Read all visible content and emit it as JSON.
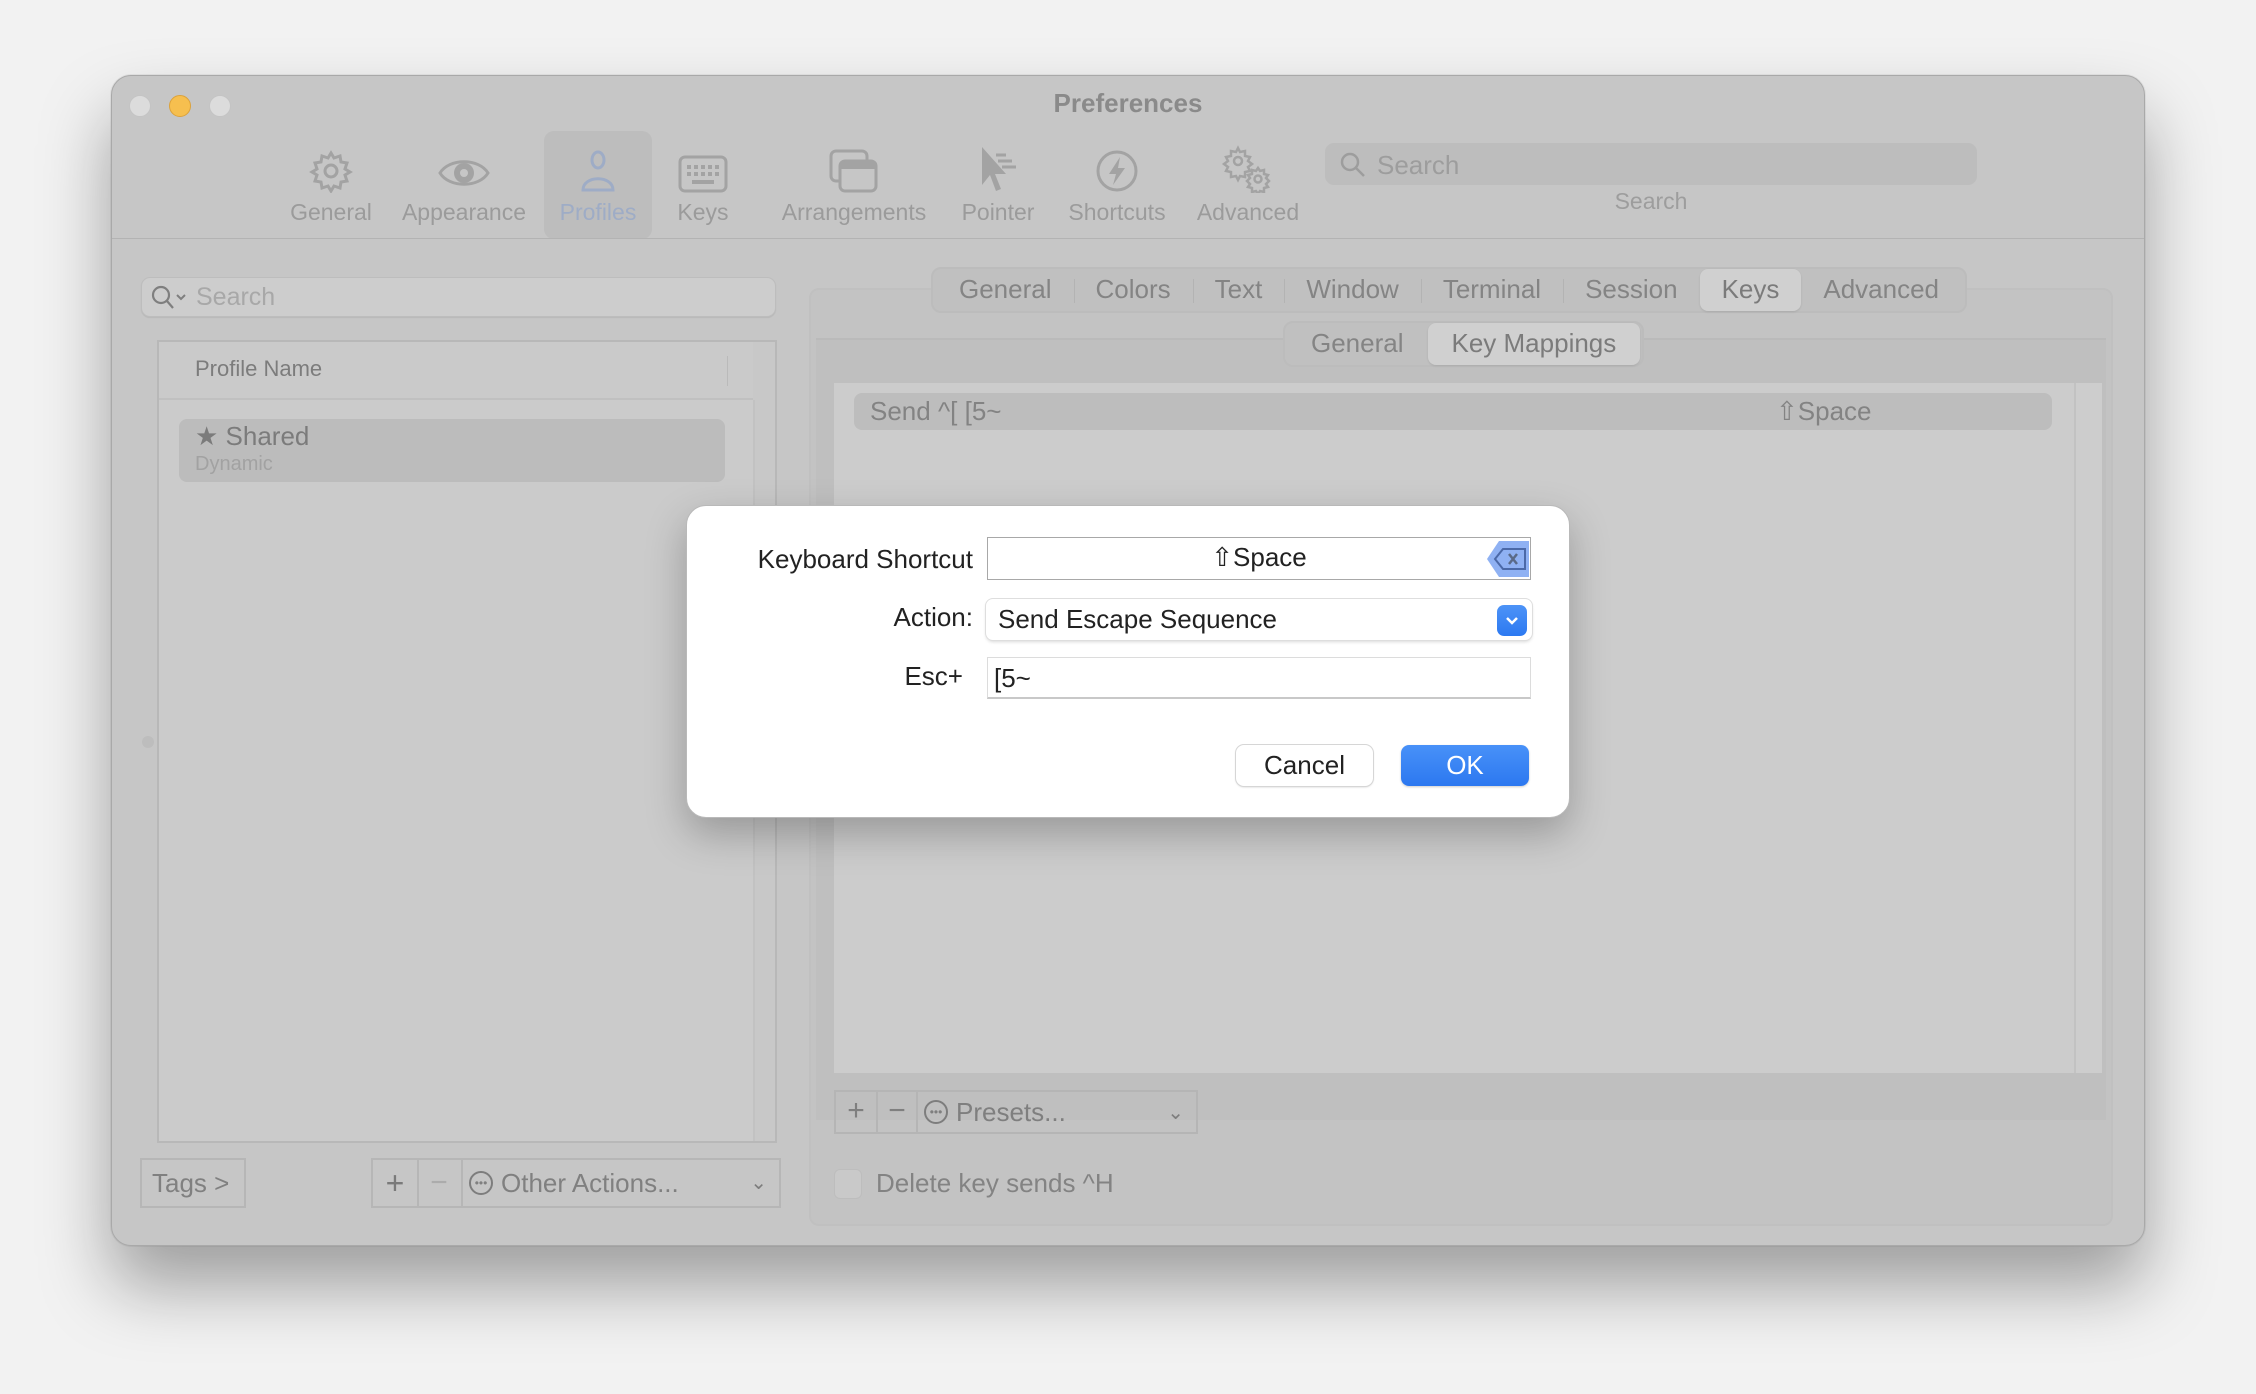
{
  "window": {
    "title": "Preferences",
    "traffic_lights": [
      "close",
      "minimize",
      "zoom"
    ]
  },
  "toolbar": {
    "items": [
      {
        "label": "General",
        "icon": "gear-icon",
        "active": false
      },
      {
        "label": "Appearance",
        "icon": "eye-icon",
        "active": false
      },
      {
        "label": "Profiles",
        "icon": "person-icon",
        "active": true
      },
      {
        "label": "Keys",
        "icon": "keyboard-icon",
        "active": false
      },
      {
        "label": "Arrangements",
        "icon": "windows-icon",
        "active": false
      },
      {
        "label": "Pointer",
        "icon": "pointer-icon",
        "active": false
      },
      {
        "label": "Shortcuts",
        "icon": "bolt-icon",
        "active": false
      },
      {
        "label": "Advanced",
        "icon": "gears-icon",
        "active": false
      }
    ],
    "search": {
      "placeholder": "Search",
      "label": "Search"
    }
  },
  "profiles_panel": {
    "search_placeholder": "Search",
    "column_header": "Profile Name",
    "profiles": [
      {
        "name": "Shared",
        "subtitle": "Dynamic",
        "starred": true,
        "selected": true
      }
    ],
    "tags_button": "Tags >",
    "add_label": "+",
    "remove_label": "−",
    "other_actions": "Other Actions..."
  },
  "profile_tabs": {
    "tabs": [
      "General",
      "Colors",
      "Text",
      "Window",
      "Terminal",
      "Session",
      "Keys",
      "Advanced"
    ],
    "active_tab": "Keys",
    "subtabs": [
      "General",
      "Key Mappings"
    ],
    "active_subtab": "Key Mappings"
  },
  "key_mappings": {
    "rows": [
      {
        "action": "Send ^[ [5~",
        "shortcut": "⇧Space",
        "selected": true
      }
    ],
    "add_label": "+",
    "remove_label": "−",
    "presets_label": "Presets...",
    "delete_key_checkbox": {
      "label": "Delete key sends ^H",
      "checked": false
    }
  },
  "dialog": {
    "shortcut_label": "Keyboard Shortcut",
    "shortcut_value": "⇧Space",
    "action_label": "Action:",
    "action_value": "Send Escape Sequence",
    "esc_label": "Esc+",
    "esc_value": "[5~",
    "cancel_label": "Cancel",
    "ok_label": "OK",
    "accent_color": "#3a84f5"
  }
}
